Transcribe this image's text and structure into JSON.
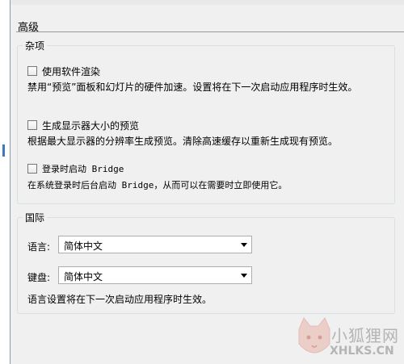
{
  "section": {
    "title": "高级"
  },
  "misc": {
    "legend": "杂项",
    "options": [
      {
        "label": "使用软件渲染",
        "checked": false,
        "desc": "禁用“预览”面板和幻灯片的硬件加速。设置将在下一次启动应用程序时生效。"
      },
      {
        "label": "生成显示器大小的预览",
        "checked": false,
        "desc": "根据最大显示器的分辨率生成预览。清除高速缓存以重新生成现有预览。"
      },
      {
        "label": "登录时启动 Bridge",
        "checked": false,
        "desc": "在系统登录时后台启动 Bridge，从而可以在需要时立即使用它。"
      }
    ]
  },
  "intl": {
    "legend": "国际",
    "language_label": "语言:",
    "language_value": "简体中文",
    "keyboard_label": "键盘:",
    "keyboard_value": "简体中文",
    "note": "语言设置将在下一次启动应用程序时生效。"
  },
  "watermark": {
    "line1": "小狐狸网",
    "line2": "XHLKS.CN"
  },
  "colors": {
    "accent": "#3b78c6",
    "group_border": "#d5dfe5",
    "background": "#f0f0f0"
  },
  "icons": {
    "dropdown": "chevron-down-icon",
    "watermark": "fox-logo-icon"
  }
}
